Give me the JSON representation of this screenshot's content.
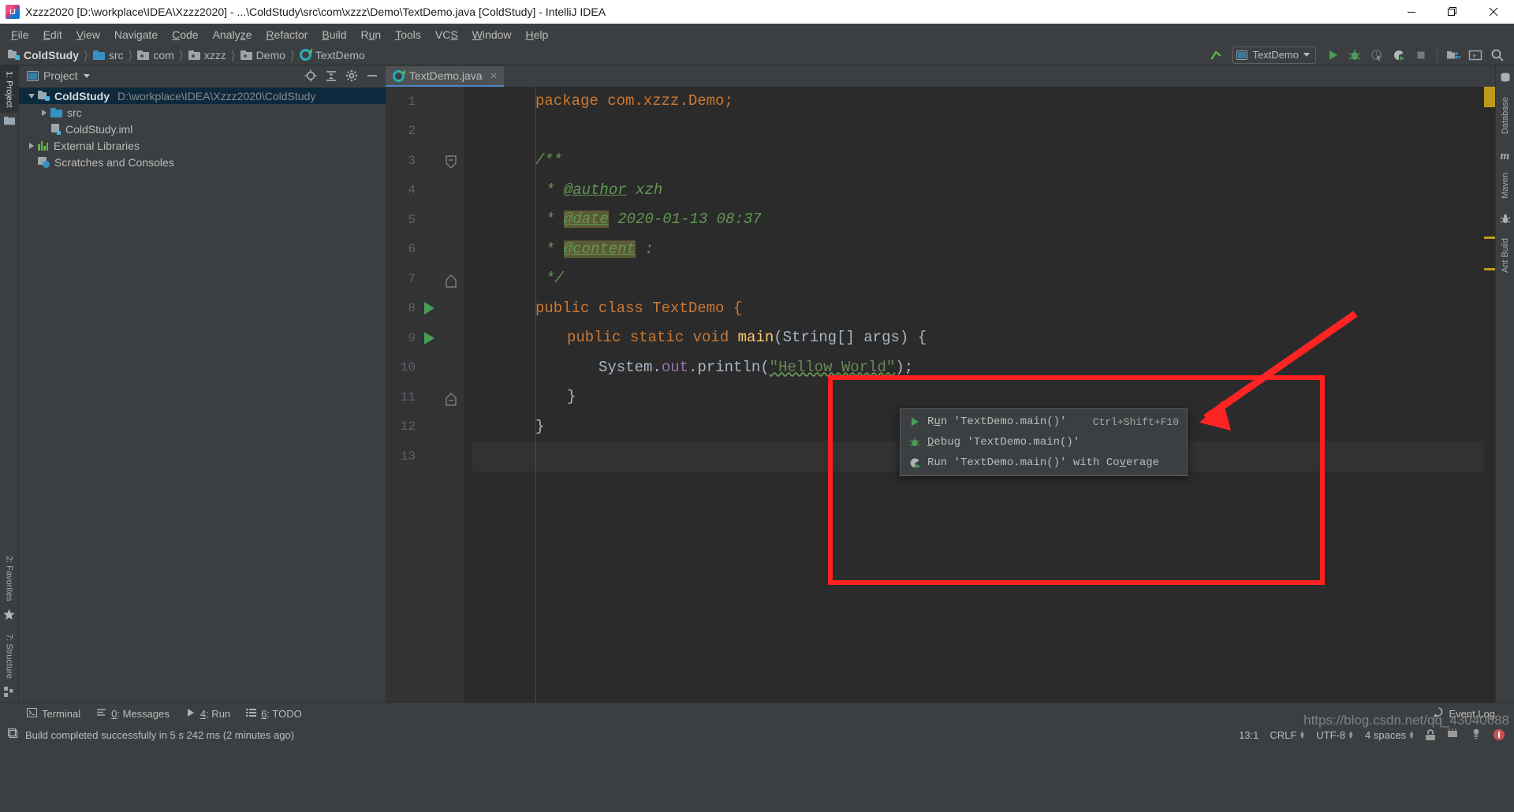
{
  "window": {
    "title": "Xzzz2020 [D:\\workplace\\IDEA\\Xzzz2020] - ...\\ColdStudy\\src\\com\\xzzz\\Demo\\TextDemo.java [ColdStudy] - IntelliJ IDEA",
    "logo_name": "intellij-idea-logo",
    "minimize": "minimize-icon",
    "maximize": "restore-icon",
    "close": "close-icon"
  },
  "menubar": {
    "items": [
      {
        "label": "File",
        "mnemonic": "F"
      },
      {
        "label": "Edit",
        "mnemonic": "E"
      },
      {
        "label": "View",
        "mnemonic": "V"
      },
      {
        "label": "Navigate",
        "mnemonic": "g"
      },
      {
        "label": "Code",
        "mnemonic": "C"
      },
      {
        "label": "Analyze",
        "mnemonic": "z"
      },
      {
        "label": "Refactor",
        "mnemonic": "R"
      },
      {
        "label": "Build",
        "mnemonic": "B"
      },
      {
        "label": "Run",
        "mnemonic": "u"
      },
      {
        "label": "Tools",
        "mnemonic": "T"
      },
      {
        "label": "VCS",
        "mnemonic": "S"
      },
      {
        "label": "Window",
        "mnemonic": "W"
      },
      {
        "label": "Help",
        "mnemonic": "H"
      }
    ]
  },
  "breadcrumb": {
    "items": [
      {
        "label": "ColdStudy",
        "icon": "module-icon"
      },
      {
        "label": "src",
        "icon": "source-folder-icon"
      },
      {
        "label": "com",
        "icon": "package-icon"
      },
      {
        "label": "xzzz",
        "icon": "package-icon"
      },
      {
        "label": "Demo",
        "icon": "package-icon"
      },
      {
        "label": "TextDemo",
        "icon": "java-class-icon"
      }
    ]
  },
  "toolbar": {
    "make_project": "make-project-icon",
    "run_config": {
      "label": "TextDemo",
      "icon": "run-configuration-icon",
      "chevron": "chevron-down-icon"
    },
    "buttons": [
      {
        "name": "run-button",
        "icon": "run-icon",
        "enabled": true
      },
      {
        "name": "debug-button",
        "icon": "debug-icon",
        "enabled": true
      },
      {
        "name": "run-with-coverage-button",
        "icon": "coverage-icon",
        "enabled": false
      },
      {
        "name": "run-with-profiler-button",
        "icon": "profiler-icon",
        "enabled": true
      },
      {
        "name": "stop-button",
        "icon": "stop-icon",
        "enabled": false
      }
    ],
    "buttons2": [
      {
        "name": "project-structure-button",
        "icon": "project-structure-icon"
      },
      {
        "name": "terminal-button",
        "icon": "terminal-icon"
      },
      {
        "name": "search-everywhere-button",
        "icon": "search-icon"
      }
    ]
  },
  "left_strip": {
    "top": [
      {
        "label": "1: Project",
        "mnemonic": "1",
        "icon": "project-folder-icon",
        "selected": true
      }
    ],
    "bottom": [
      {
        "label": "2: Favorites",
        "mnemonic": "2",
        "icon": "star-icon",
        "selected": false
      },
      {
        "label": "7: Structure",
        "mnemonic": "7",
        "icon": "structure-icon",
        "selected": false
      }
    ]
  },
  "right_strip": {
    "items": [
      {
        "label": "Database",
        "icon": "database-icon"
      },
      {
        "label": "Maven",
        "icon": "maven-icon"
      },
      {
        "label": "Ant Build",
        "icon": "ant-icon"
      }
    ]
  },
  "project_panel": {
    "title": "Project",
    "chevron": "chevron-down-icon",
    "actions": [
      {
        "name": "select-opened-file-button",
        "icon": "target-icon"
      },
      {
        "name": "collapse-all-button",
        "icon": "collapse-all-icon"
      },
      {
        "name": "settings-button",
        "icon": "gear-icon"
      },
      {
        "name": "hide-button",
        "icon": "minimize-icon"
      }
    ],
    "tree": [
      {
        "label": "ColdStudy",
        "detail": "D:\\workplace\\IDEA\\Xzzz2020\\ColdStudy",
        "icon": "module-icon",
        "indent": 0,
        "twisty": "down",
        "bold": true,
        "selected": true
      },
      {
        "label": "src",
        "detail": "",
        "icon": "source-folder-icon",
        "indent": 1,
        "twisty": "right",
        "bold": false,
        "selected": false
      },
      {
        "label": "ColdStudy.iml",
        "detail": "",
        "icon": "iml-file-icon",
        "indent": 1,
        "twisty": "none",
        "bold": false,
        "selected": false
      },
      {
        "label": "External Libraries",
        "detail": "",
        "icon": "libraries-icon",
        "indent": 0,
        "twisty": "right",
        "bold": false,
        "selected": false
      },
      {
        "label": "Scratches and Consoles",
        "detail": "",
        "icon": "scratches-icon",
        "indent": 0,
        "twisty": "none",
        "bold": false,
        "selected": false
      }
    ]
  },
  "editor": {
    "tabs": [
      {
        "label": "TextDemo.java",
        "icon": "java-class-icon",
        "close": "close-icon",
        "active": true
      }
    ],
    "lines": [
      {
        "num": "1",
        "run": false,
        "fold": "none",
        "current": false
      },
      {
        "num": "2",
        "run": false,
        "fold": "none",
        "current": false
      },
      {
        "num": "3",
        "run": false,
        "fold": "start",
        "current": false
      },
      {
        "num": "4",
        "run": false,
        "fold": "none",
        "current": false
      },
      {
        "num": "5",
        "run": false,
        "fold": "none",
        "current": false
      },
      {
        "num": "6",
        "run": false,
        "fold": "none",
        "current": false
      },
      {
        "num": "7",
        "run": false,
        "fold": "end",
        "current": false
      },
      {
        "num": "8",
        "run": true,
        "fold": "none",
        "current": false
      },
      {
        "num": "9",
        "run": true,
        "fold": "none",
        "current": false
      },
      {
        "num": "10",
        "run": false,
        "fold": "none",
        "current": false
      },
      {
        "num": "11",
        "run": false,
        "fold": "end",
        "current": false
      },
      {
        "num": "12",
        "run": false,
        "fold": "none",
        "current": false
      },
      {
        "num": "13",
        "run": false,
        "fold": "none",
        "current": true
      }
    ],
    "code": {
      "l1": "package com.xzzz.Demo;",
      "l3": "/**",
      "l4_star": "*",
      "l4_tag": "@author",
      "l4_val": "xzh",
      "l5_tag": "@date",
      "l5_val": "2020-01-13 08:37",
      "l6_tag": "@content",
      "l6_val": ":",
      "l7": "*/",
      "l8": "public class TextDemo {",
      "l9": "public static void main(String[] args) {",
      "l10_a": "System.",
      "l10_b": "out",
      "l10_c": ".println(",
      "l10_str": "\"Hellow World\"",
      "l10_d": ");",
      "l11": "}",
      "l12": "}"
    }
  },
  "context_menu": {
    "items": [
      {
        "label": "Run 'TextDemo.main()'",
        "mnemonic": "u",
        "accel": "Ctrl+Shift+F10",
        "icon": "run-icon"
      },
      {
        "label": "Debug 'TextDemo.main()'",
        "mnemonic": "D",
        "accel": "",
        "icon": "debug-icon"
      },
      {
        "label": "Run 'TextDemo.main()' with Coverage",
        "mnemonic": "v",
        "accel": "",
        "icon": "coverage-icon"
      }
    ]
  },
  "annotation": {
    "box_color": "#ff2020",
    "arrow_color": "#ff2424",
    "box_name": "red-highlight-box",
    "arrow_name": "red-pointer-arrow"
  },
  "bottom_bar": {
    "items": [
      {
        "label": "Terminal",
        "mnemonic": "",
        "icon": "terminal-icon"
      },
      {
        "label": "0: Messages",
        "mnemonic": "0",
        "icon": "messages-icon"
      },
      {
        "label": "4: Run",
        "mnemonic": "4",
        "icon": "run-icon"
      },
      {
        "label": "6: TODO",
        "mnemonic": "6",
        "icon": "todo-icon"
      }
    ],
    "event_log": {
      "label": "Event Log",
      "icon": "event-log-icon"
    }
  },
  "statusbar": {
    "message": "Build completed successfully in 5 s 242 ms (2 minutes ago)",
    "message_icon": "build-icon",
    "caret_position": "13:1",
    "line_separator": "CRLF",
    "encoding": "UTF-8",
    "indent": "4 spaces",
    "lock_icon": "lock-icon",
    "memory_icon": "memory-indicator",
    "inspection_icon": "inspections-icon",
    "notification_icon": "error-notification-icon"
  },
  "watermark": {
    "text": "https://blog.csdn.net/qq_43040688"
  },
  "colors": {
    "accent_green": "#499c54",
    "accent_blue": "#4a88c7",
    "editor_bg": "#2b2b2b",
    "panel_bg": "#3c3f41",
    "gutter_bg": "#313335",
    "selection_blue": "#0d293e",
    "warning_marker": "#bd9c1d"
  }
}
